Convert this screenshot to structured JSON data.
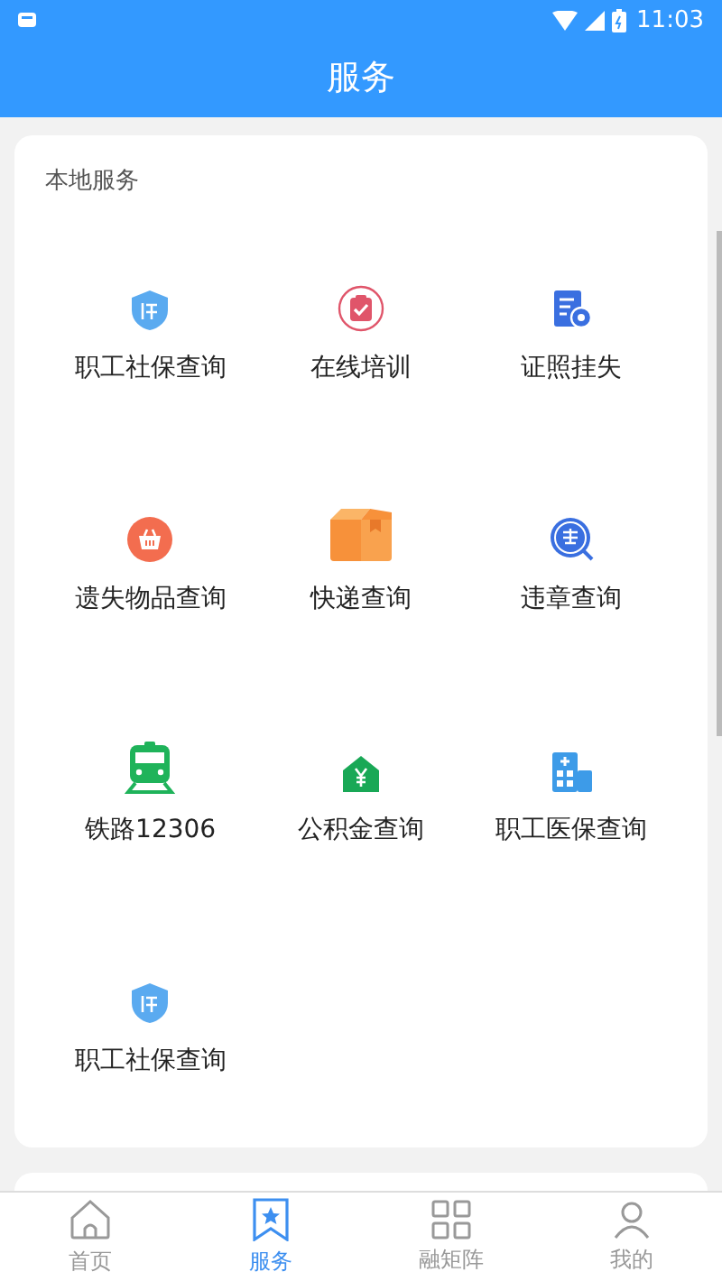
{
  "status_bar": {
    "time": "11:03"
  },
  "header": {
    "title": "服务"
  },
  "section": {
    "title": "本地服务",
    "items": [
      {
        "label": "职工社保查询"
      },
      {
        "label": "在线培训"
      },
      {
        "label": "证照挂失"
      },
      {
        "label": "遗失物品查询"
      },
      {
        "label": "快递查询"
      },
      {
        "label": "违章查询"
      },
      {
        "label": "铁路12306"
      },
      {
        "label": "公积金查询"
      },
      {
        "label": "职工医保查询"
      },
      {
        "label": "职工社保查询"
      }
    ]
  },
  "tabs": [
    {
      "label": "首页",
      "selected": false
    },
    {
      "label": "服务",
      "selected": true
    },
    {
      "label": "融矩阵",
      "selected": false
    },
    {
      "label": "我的",
      "selected": false
    }
  ]
}
